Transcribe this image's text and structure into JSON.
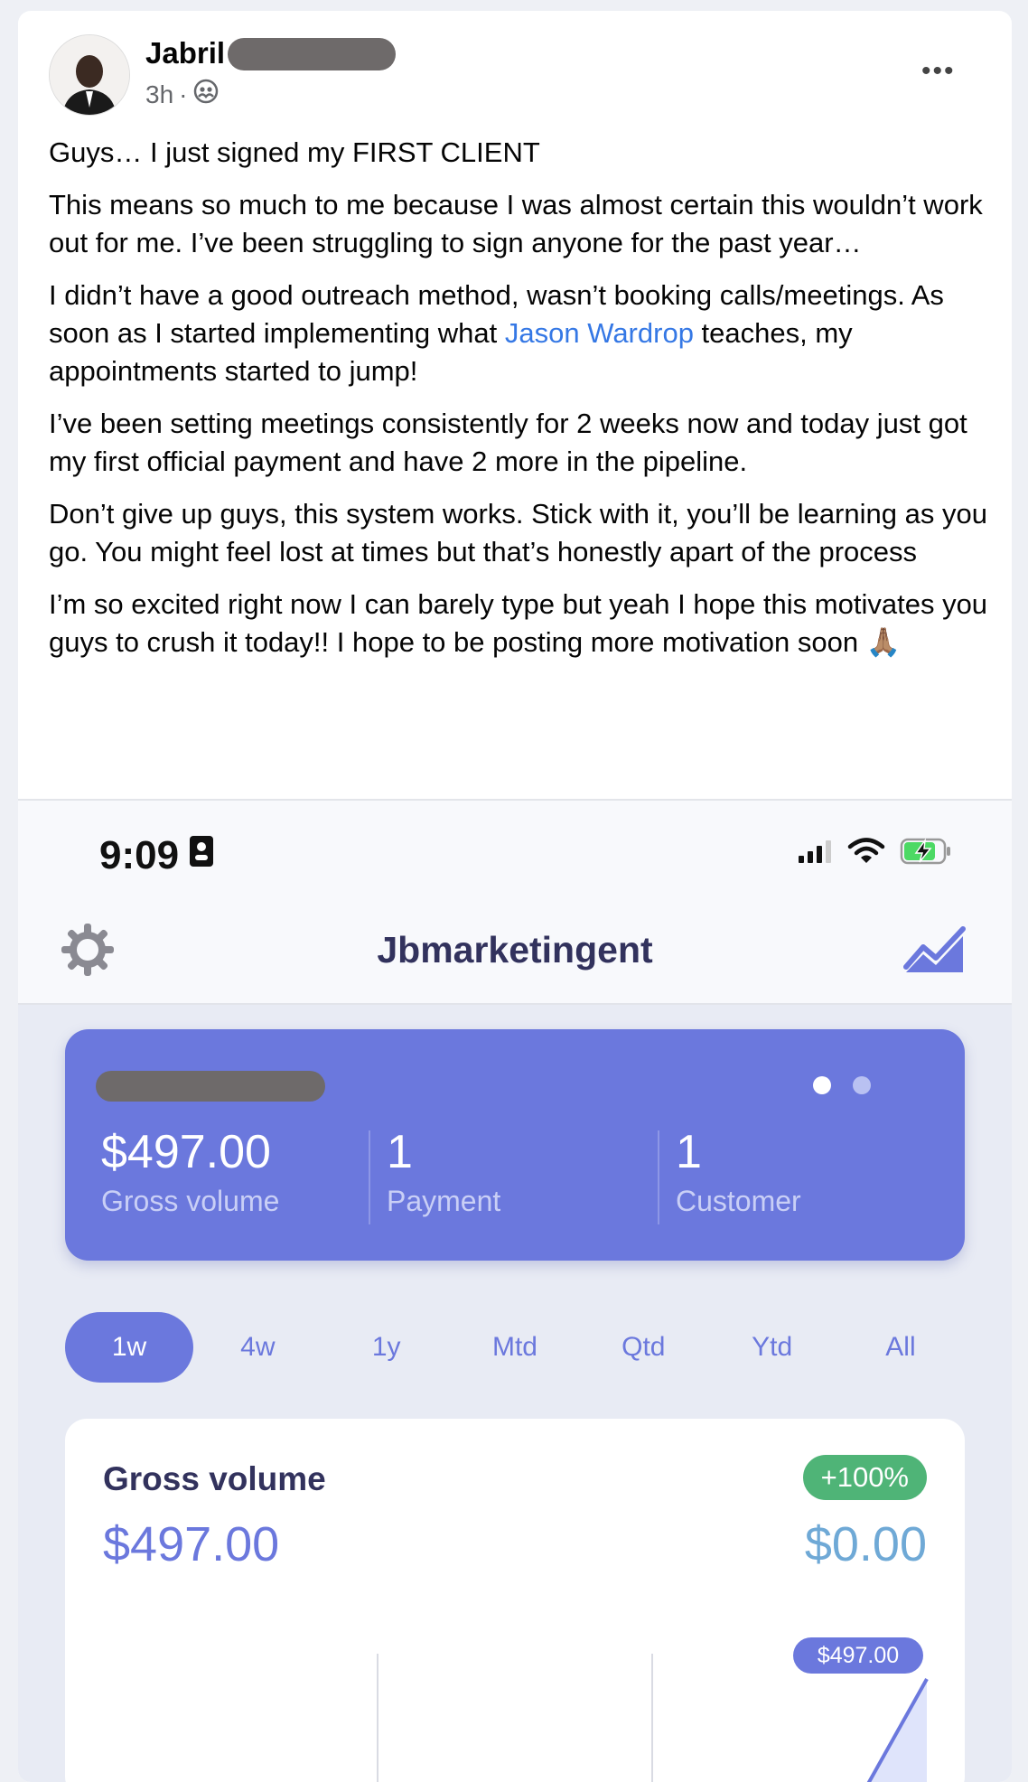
{
  "post": {
    "author": "Jabril",
    "time": "3h",
    "more": "•••",
    "p1": "Guys… I just signed my FIRST CLIENT",
    "p2": "This means so much to me because I was almost certain this wouldn’t work out for me. I’ve been struggling to sign anyone for the past year…",
    "p3_before": "I didn’t have a good outreach method, wasn’t booking calls/meetings. As soon as I started implementing what ",
    "p3_link": "Jason Wardrop",
    "p3_after": " teaches, my appointments started to jump!",
    "p4": "I’ve been setting meetings consistently for 2 weeks now and today just got my first official payment and have 2 more in the pipeline.",
    "p5": "Don’t give up guys, this system works. Stick with it, you’ll be learning as you go. You might feel lost at times but that’s honestly apart of the process",
    "p6": "I’m so excited right now I can barely type but yeah I hope this motivates you guys to crush it today!! I hope to be posting more motivation soon 🙏🏽"
  },
  "phone": {
    "time": "9:09",
    "app_title": "Jbmarketingent",
    "summary": {
      "gross_value": "$497.00",
      "gross_label": "Gross volume",
      "payments_value": "1",
      "payments_label": "Payment",
      "customers_value": "1",
      "customers_label": "Customer"
    },
    "periods": [
      "1w",
      "4w",
      "1y",
      "Mtd",
      "Qtd",
      "Ytd",
      "All"
    ],
    "active_period": "1w",
    "gross_card": {
      "title": "Gross volume",
      "value": "$497.00",
      "change": "+100%",
      "previous": "$0.00",
      "tooltip": "$497.00"
    }
  },
  "colors": {
    "accent": "#6b78dd",
    "link": "#3578e5",
    "positive": "#4fb477"
  }
}
